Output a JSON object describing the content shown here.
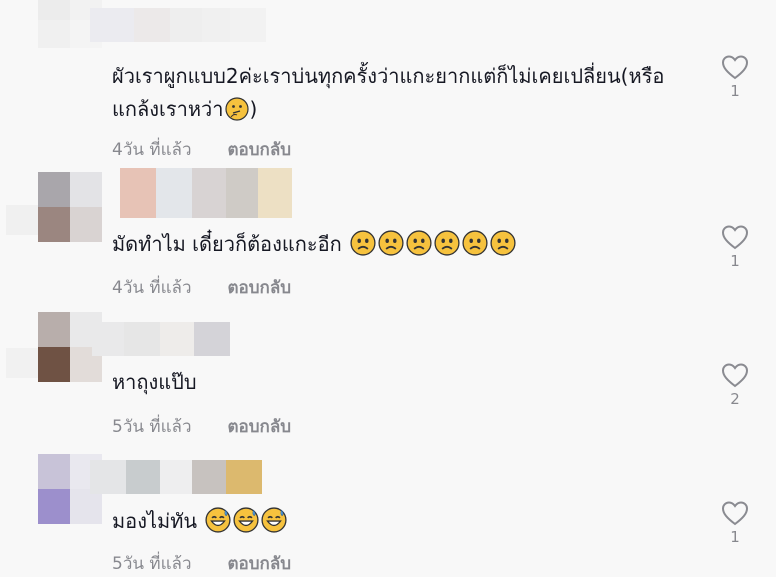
{
  "comments": [
    {
      "text": "ผัวเราผูกแบบ2ค่ะเราบ่นทุกครั้งว่าแกะยากแต่ก็ไม่เคยเปลี่ยน(หรือแกล้งเราหว่า",
      "emoji": [
        "thinking-face"
      ],
      "time": "4วัน ที่แล้ว",
      "reply": "ตอบกลับ",
      "likes": "1"
    },
    {
      "text": "มัดทำไม เดี๋ยวก็ต้องแกะอีก",
      "emoji": [
        "sad-face",
        "sad-face",
        "sad-face",
        "sad-face",
        "sad-face",
        "sad-face"
      ],
      "time": "4วัน ที่แล้ว",
      "reply": "ตอบกลับ",
      "likes": "1"
    },
    {
      "text": "หาถุงแป๊บ",
      "emoji": [],
      "time": "5วัน ที่แล้ว",
      "reply": "ตอบกลับ",
      "likes": "2"
    },
    {
      "text": "มองไม่ทัน",
      "emoji": [
        "sweat-smile-face",
        "sweat-smile-face",
        "sweat-smile-face"
      ],
      "time": "5วัน ที่แล้ว",
      "reply": "ตอบกลับ",
      "likes": "1"
    }
  ]
}
